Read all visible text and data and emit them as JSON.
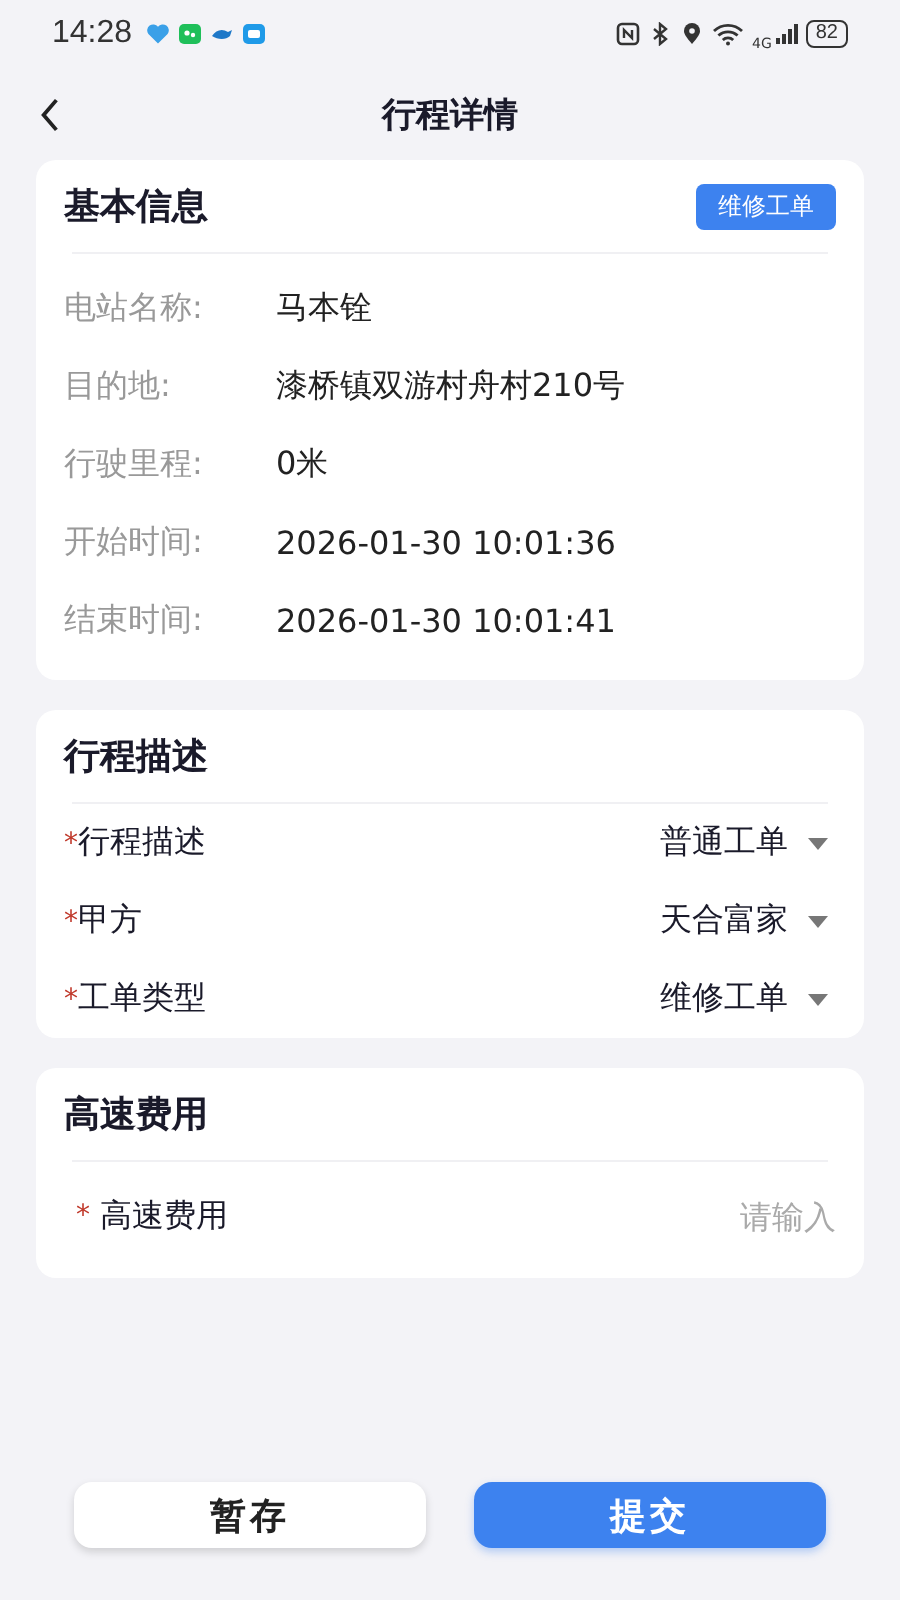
{
  "status_bar": {
    "time": "14:28",
    "network": "4G",
    "battery": "82"
  },
  "header": {
    "title": "行程详情"
  },
  "basic_info": {
    "title": "基本信息",
    "tag": "维修工单",
    "fields": [
      {
        "label": "电站名称:",
        "value": "马本铨"
      },
      {
        "label": "目的地:",
        "value": "漆桥镇双游村舟村210号"
      },
      {
        "label": "行驶里程:",
        "value": "0米"
      },
      {
        "label": "开始时间:",
        "value": "2026-01-30 10:01:36"
      },
      {
        "label": "结束时间:",
        "value": "2026-01-30 10:01:41"
      }
    ]
  },
  "trip_description": {
    "title": "行程描述",
    "selects": [
      {
        "required_mark": "*",
        "label": "行程描述",
        "value": "普通工单"
      },
      {
        "required_mark": "*",
        "label": "甲方",
        "value": "天合富家"
      },
      {
        "required_mark": "*",
        "label": "工单类型",
        "value": "维修工单"
      }
    ]
  },
  "highway_fee": {
    "title": "高速费用",
    "field": {
      "required_mark": "*",
      "label": "高速费用",
      "placeholder": "请输入"
    }
  },
  "buttons": [
    {
      "kind": "secondary",
      "label": "暂存"
    },
    {
      "kind": "primary",
      "label": "提交"
    }
  ]
}
